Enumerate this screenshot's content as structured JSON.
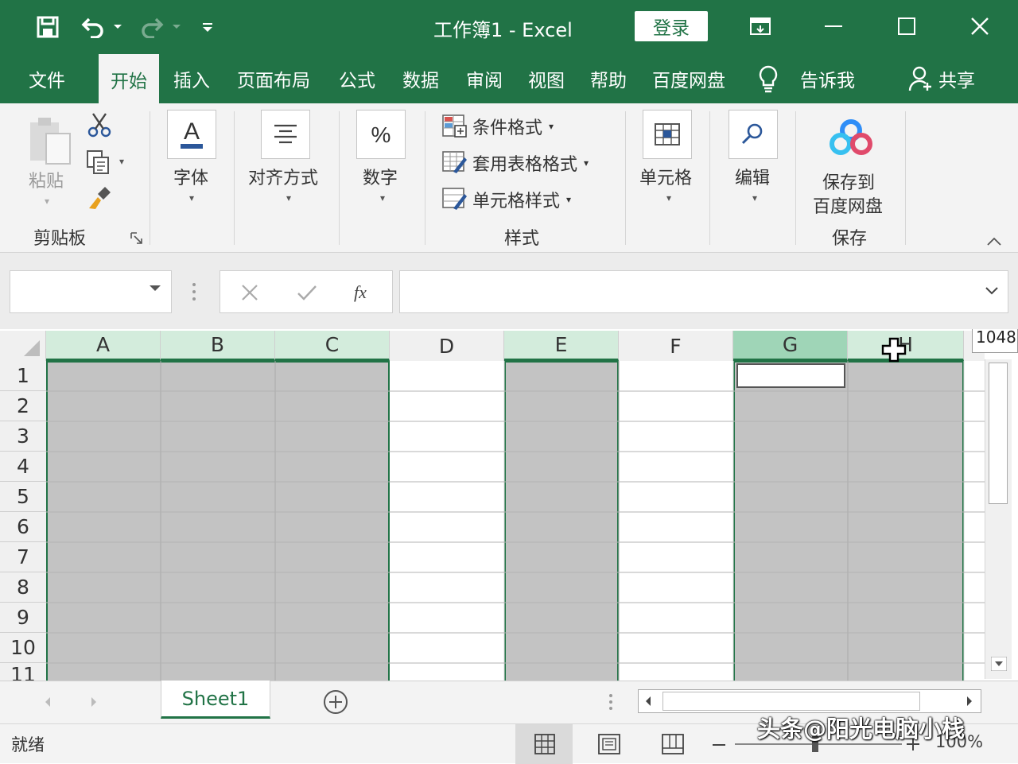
{
  "window": {
    "title": "工作簿1  -  Excel",
    "login_label": "登录"
  },
  "colors": {
    "brand": "#217346",
    "selection": "#c3c3c3",
    "active_header": "#9fd5b7"
  },
  "menu": {
    "tabs": [
      {
        "label": "文件"
      },
      {
        "label": "开始"
      },
      {
        "label": "插入"
      },
      {
        "label": "页面布局"
      },
      {
        "label": "公式"
      },
      {
        "label": "数据"
      },
      {
        "label": "审阅"
      },
      {
        "label": "视图"
      },
      {
        "label": "帮助"
      },
      {
        "label": "百度网盘"
      }
    ],
    "tell_me": "告诉我",
    "share": "共享"
  },
  "ribbon": {
    "clipboard": {
      "paste_label": "粘贴",
      "group_label": "剪贴板"
    },
    "font_label": "字体",
    "alignment_label": "对齐方式",
    "number_label": "数字",
    "styles": {
      "conditional_format": "条件格式",
      "format_as_table": "套用表格格式",
      "cell_styles": "单元格样式",
      "group_label": "样式"
    },
    "cells_label": "单元格",
    "editing_label": "编辑",
    "save_to_baidu": {
      "line1": "保存到",
      "line2": "百度网盘",
      "group_label": "保存"
    }
  },
  "formula_bar": {
    "name_box": "",
    "formula": ""
  },
  "grid": {
    "columns": [
      "A",
      "B",
      "C",
      "D",
      "E",
      "F",
      "G",
      "H"
    ],
    "rows": [
      "1",
      "2",
      "3",
      "4",
      "5",
      "6",
      "7",
      "8",
      "9",
      "10",
      "11"
    ],
    "selected_columns": [
      "A",
      "B",
      "C",
      "E",
      "G",
      "H"
    ],
    "active_cell": "G1",
    "tooltip": "1048"
  },
  "sheets": {
    "tabs": [
      "Sheet1"
    ]
  },
  "status": {
    "ready": "就绪",
    "zoom": "100%"
  },
  "watermark": "头条@阳光电脑小栈"
}
